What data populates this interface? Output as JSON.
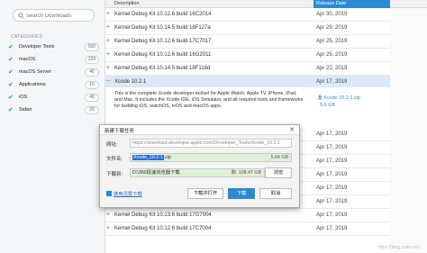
{
  "search": {
    "placeholder": "Search Downloads"
  },
  "categories": {
    "title": "CATEGORIES",
    "items": [
      {
        "label": "Developer Tools",
        "count": "500"
      },
      {
        "label": "macOS",
        "count": "229"
      },
      {
        "label": "macOS Server",
        "count": "46"
      },
      {
        "label": "Applications",
        "count": "16"
      },
      {
        "label": "iOS",
        "count": "48"
      },
      {
        "label": "Safari",
        "count": "20"
      }
    ]
  },
  "table": {
    "col_description": "Description",
    "col_date": "Release Date",
    "rows": [
      {
        "name": "Kernel Debug Kit 10.12.6 build 16C2014",
        "date": "Apr 30, 2019"
      },
      {
        "name": "Kernel Debug Kit 10.14.5 build 18F127a",
        "date": "Apr 29, 2019"
      },
      {
        "name": "Kernel Debug Kit 10.12.6 build 17C7017",
        "date": "Apr 25, 2019"
      },
      {
        "name": "Kernel Debug Kit 10.12.6 build 16G2011",
        "date": "Apr 25, 2019"
      },
      {
        "name": "Kernel Debug Kit 10.14.5 build 18F118d",
        "date": "Apr 22, 2019"
      },
      {
        "name": "Xcode 10.2.1",
        "date": "Apr 17, 2019"
      }
    ],
    "expanded": {
      "text": "This is the complete Xcode developer toolset for Apple Watch, Apple TV, iPhone, iPad, and Mac. It includes the Xcode IDE, iOS Simulator, and all required tools and frameworks for building iOS, watchOS, tvOS and macOS apps.",
      "file": "Xcode 10.2.1.xip",
      "size": "5.6 GB"
    },
    "rows_after": [
      {
        "name": "",
        "date": "Apr 17, 2019"
      },
      {
        "name": "",
        "date": "Apr 17, 2019"
      },
      {
        "name": "",
        "date": "Apr 17, 2019"
      },
      {
        "name": "",
        "date": "Apr 17, 2019"
      },
      {
        "name": "",
        "date": "Apr 17, 2019"
      },
      {
        "name": "",
        "date": "Apr 17, 2019"
      },
      {
        "name": "Kernel Debug Kit 10.13.6 build 17G7004",
        "date": "Apr 17, 2019"
      },
      {
        "name": "Kernel Debug Kit 10.12.6 build 17C7004",
        "date": "Apr 17, 2019"
      }
    ]
  },
  "dialog": {
    "title": "新建下载任务",
    "url_label": "网址:",
    "url_value": "https://download.developer.apple.com/Developer_Tools/Xcode_10.2.1",
    "filename_label": "文件名:",
    "filename_value": "Xcode_10.2.1",
    "filename_ext": ".xip",
    "filename_size": "5.64 GB",
    "path_label": "下载到:",
    "path_value": "D:\\360极速浏览器下载",
    "path_free": "剩: 108.47 GB",
    "browse_label": "浏览",
    "thunder_label": "使用迅雷下载",
    "open_label": "下载并打开",
    "download_label": "下载",
    "cancel_label": "取消"
  },
  "watermark": "https://blog.csdn.net/..."
}
